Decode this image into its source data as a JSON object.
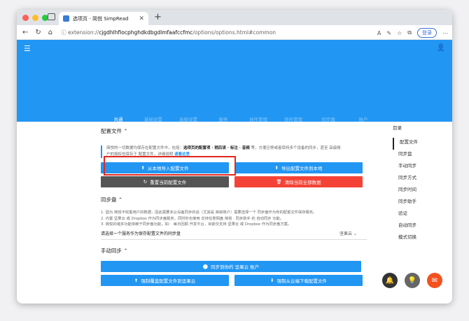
{
  "browser": {
    "tab_title": "选项页 - 简悦 SimpRead",
    "url_prefix": "extension://",
    "url_host": "cjgdhlhfiocphghdkdbgdlmfaafccfmc",
    "url_path": "/options/options.html#common",
    "login_label": "登录"
  },
  "tabs": [
    "共通",
    "基础设置",
    "高级设置",
    "服务",
    "插件管理",
    "插件管理",
    "同步器",
    "账户"
  ],
  "sections": {
    "config": {
      "title": "配置文件",
      "note_a": "简悦的一切数据均保存在配置文件中，包括：",
      "note_b": "选项页的配置项 · 稍后读 · 标注 · 音频",
      "note_c": " 等，方便迁移或者保持多个设备的同步，甚至 高级账",
      "note_d": "户的授权也保存于 配置文件，详细说明 ",
      "note_link": "请看这里",
      "import_label": "从本地导入配置文件",
      "export_label": "导出配置文件到本地",
      "reset_label": "重置当前配置文件",
      "clear_label": "清除当前全部数据"
    },
    "sync": {
      "title": "同步盘",
      "line1": "1. 因为 简悦不收集用户的数据，因此需要多台设备同步的话（尤其是 高级账户）需要选择一个 同步盘作为你的配置文件保存服务。",
      "line2": "2. 内置 坚果云 或 Dropbox 作为同步盘服务，同时你也使用 支持任意网盘 简悦 · 同步助手 的 自动同步 功能。",
      "line3": "3. 简悦的诸多功能依赖于同步盘功能，如： 每日回顾 开发平台，目前仅支持 坚果云 或 Dropbox 作为同步盘方案。",
      "select_label": "请选择一个服务作为保存配置文件的同步盘",
      "select_value": "坚果云"
    },
    "manual": {
      "title": "手动同步",
      "sync_to_label": "同步到你的 坚果云 账户",
      "upload_label": "强制覆盖配置文件到坚果云",
      "download_label": "强制从云端下载配置文件"
    }
  },
  "toc": {
    "title": "目录",
    "items": [
      "配置文件",
      "同步盘",
      "手动同步",
      "同步方式",
      "同步时间",
      "同步助手",
      "验证",
      "自动同步",
      "模式切换"
    ]
  },
  "colors": {
    "primary": "#2196f3",
    "danger": "#f44336",
    "highlight": "#e0281e"
  }
}
